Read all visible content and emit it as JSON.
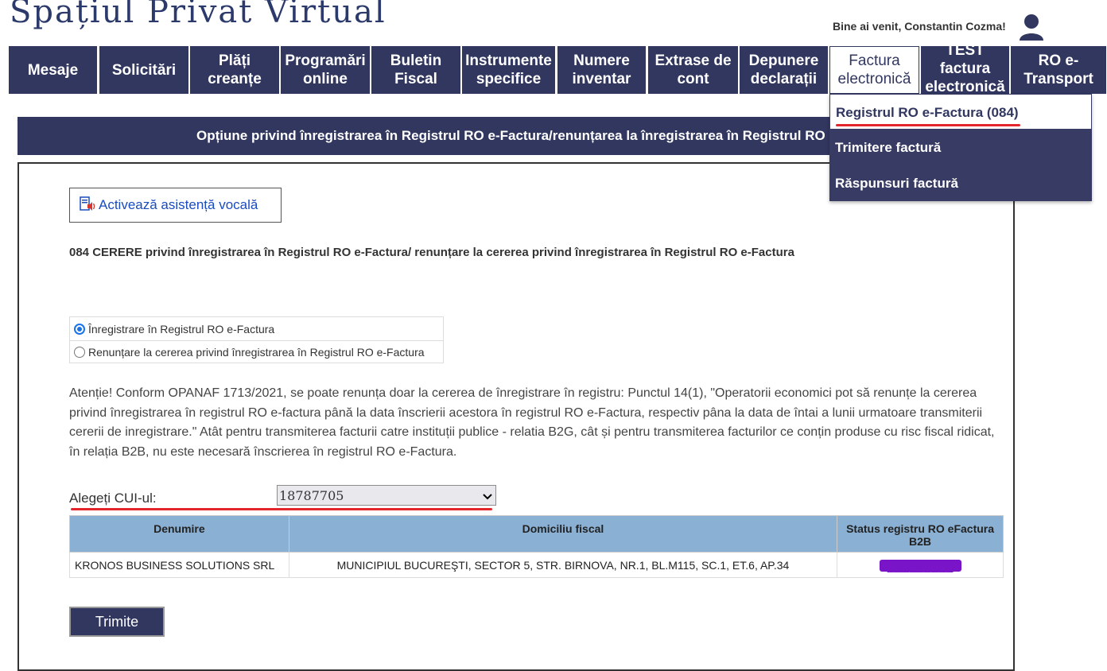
{
  "header": {
    "logo_text": "Spațiul Privat Virtual",
    "welcome": "Bine ai venit, Constantin Cozma!"
  },
  "nav": {
    "items": [
      {
        "label": "Mesaje"
      },
      {
        "label": "Solicitări"
      },
      {
        "label": "Plăți creanțe"
      },
      {
        "label": "Programări online"
      },
      {
        "label": "Buletin Fiscal"
      },
      {
        "label": "Instrumente specifice"
      },
      {
        "label": "Numere inventar"
      },
      {
        "label": "Extrase de cont"
      },
      {
        "label": "Depunere declarații"
      },
      {
        "label": "Factura electronică"
      },
      {
        "label": "TEST factura electronică"
      },
      {
        "label": "RO e-Transport"
      }
    ]
  },
  "dropdown": {
    "items": [
      {
        "label": "Registrul RO e-Factura (084)"
      },
      {
        "label": "Trimitere factură"
      },
      {
        "label": "Răspunsuri factură"
      }
    ]
  },
  "title_bar": "Opțiune privind înregistrarea în Registrul RO e-Factura/renunțarea la înregistrarea în Registrul RO e-Factura",
  "voice_assist": "Activează asistență vocală",
  "form_title": "084 CERERE privind înregistrarea în Registrul RO e-Factura/ renunțare la cererea privind înregistrarea în Registrul RO e-Factura",
  "options": {
    "register": "Înregistrare în Registrul RO e-Factura",
    "withdraw": "Renunțare la cererea privind înregistrarea în Registrul RO e-Factura"
  },
  "notice": "Atenție! Conform OPANAF 1713/2021, se poate renunța doar la cererea de înregistrare în registru: Punctul 14(1), \"Operatorii economici pot să renunțe la cererea privind înregistrarea în registrul RO e-factura până la data înscrierii acestora în registrul RO e-Factura, respectiv pâna la data de întai a lunii urmatoare transmiterii cererii de inregistrare.\" Atât pentru transmiterea facturii catre instituții publice - relatia B2G, cât și pentru transmiterea facturilor ce conțin produse cu risc fiscal ridicat, în relația B2B, nu este necesară înscrierea în registrul RO e-Factura.",
  "cui": {
    "label": "Alegeți CUI-ul:",
    "selected": "18787705"
  },
  "table": {
    "headers": [
      "Denumire",
      "Domiciliu fiscal",
      "Status registru RO eFactura B2B"
    ],
    "rows": [
      [
        "KRONOS BUSINESS SOLUTIONS SRL",
        "MUNICIPIUL BUCUREŞTI, SECTOR 5, STR. BIRNOVA, NR.1, BL.M115, SC.1, ET.6, AP.34"
      ]
    ]
  },
  "submit": "Trimite",
  "colors": {
    "nav_bg": "#323760",
    "header_row": "#8ab0d4",
    "accent_underline": "#e3262b",
    "redaction": "#7a14c9"
  }
}
